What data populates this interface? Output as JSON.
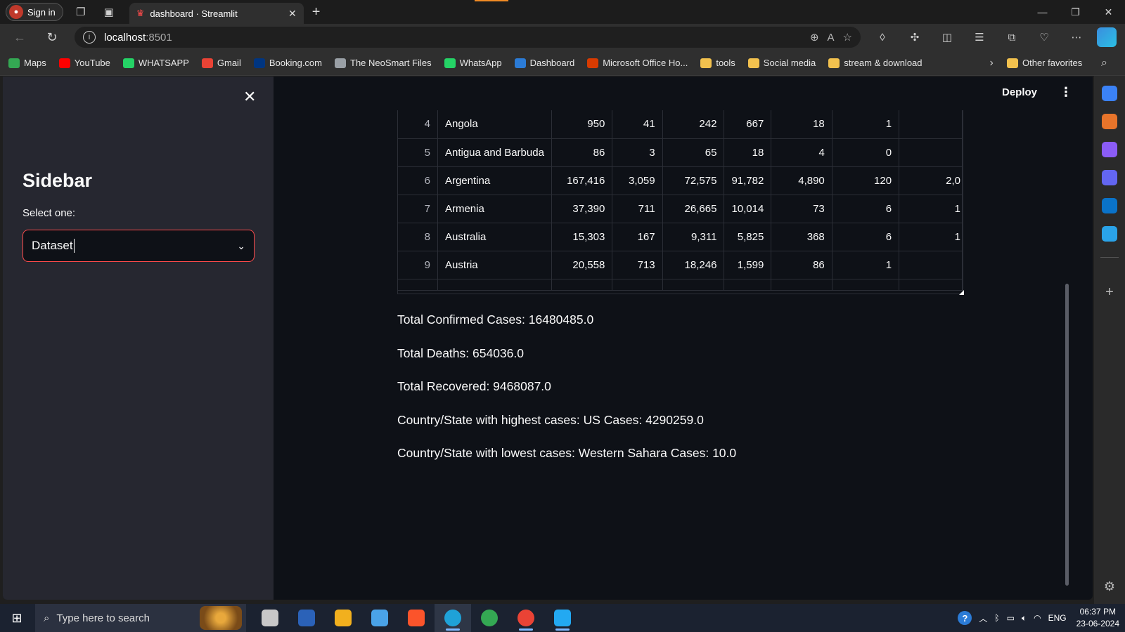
{
  "browser": {
    "signin_label": "Sign in",
    "tab_title": "dashboard · Streamlit",
    "url_host": "localhost",
    "url_port": ":8501"
  },
  "favorites": [
    {
      "label": "Maps",
      "color": "#34a853"
    },
    {
      "label": "YouTube",
      "color": "#ff0000"
    },
    {
      "label": "WHATSAPP",
      "color": "#25d366"
    },
    {
      "label": "Gmail",
      "color": "#ea4335"
    },
    {
      "label": "Booking.com",
      "color": "#003580"
    },
    {
      "label": "The NeoSmart Files",
      "color": "#9aa0a6"
    },
    {
      "label": "WhatsApp",
      "color": "#25d366"
    },
    {
      "label": "Dashboard",
      "color": "#2b7bd6"
    },
    {
      "label": "Microsoft Office Ho...",
      "color": "#d83b01"
    },
    {
      "label": "tools",
      "color": "#f2c14e"
    },
    {
      "label": "Social media",
      "color": "#f2c14e"
    },
    {
      "label": "stream & download",
      "color": "#f2c14e"
    }
  ],
  "favorites_other": "Other favorites",
  "app": {
    "deploy_label": "Deploy",
    "sidebar": {
      "title": "Sidebar",
      "select_label": "Select one:",
      "select_value": "Dataset"
    },
    "table": {
      "rows": [
        [
          "4",
          "Angola",
          "950",
          "41",
          "242",
          "667",
          "18",
          "1",
          ""
        ],
        [
          "5",
          "Antigua and Barbuda",
          "86",
          "3",
          "65",
          "18",
          "4",
          "0",
          ""
        ],
        [
          "6",
          "Argentina",
          "167,416",
          "3,059",
          "72,575",
          "91,782",
          "4,890",
          "120",
          "2,0"
        ],
        [
          "7",
          "Armenia",
          "37,390",
          "711",
          "26,665",
          "10,014",
          "73",
          "6",
          "1"
        ],
        [
          "8",
          "Australia",
          "15,303",
          "167",
          "9,311",
          "5,825",
          "368",
          "6",
          "1"
        ],
        [
          "9",
          "Austria",
          "20,558",
          "713",
          "18,246",
          "1,599",
          "86",
          "1",
          ""
        ]
      ]
    },
    "stats": [
      "Total Confirmed Cases: 16480485.0",
      "Total Deaths: 654036.0",
      "Total Recovered: 9468087.0",
      "Country/State with highest cases: US Cases: 4290259.0",
      "Country/State with lowest cases: Western Sahara Cases: 10.0"
    ]
  },
  "taskbar": {
    "search_placeholder": "Type here to search",
    "language": "ENG",
    "time": "06:37 PM",
    "date": "23-06-2024",
    "apps": [
      {
        "name": "task-view",
        "color": "#c8c8c8"
      },
      {
        "name": "powershell",
        "color": "#2b62b8"
      },
      {
        "name": "store",
        "color": "#f2b01e"
      },
      {
        "name": "files",
        "color": "#4aa3e8"
      },
      {
        "name": "brave",
        "color": "#fb542b"
      },
      {
        "name": "edge",
        "color": "#1fa2d8"
      },
      {
        "name": "chrome",
        "color": "#34a853"
      },
      {
        "name": "chrome-profile",
        "color": "#ea4335"
      },
      {
        "name": "vscode",
        "color": "#23a9f2"
      }
    ]
  }
}
